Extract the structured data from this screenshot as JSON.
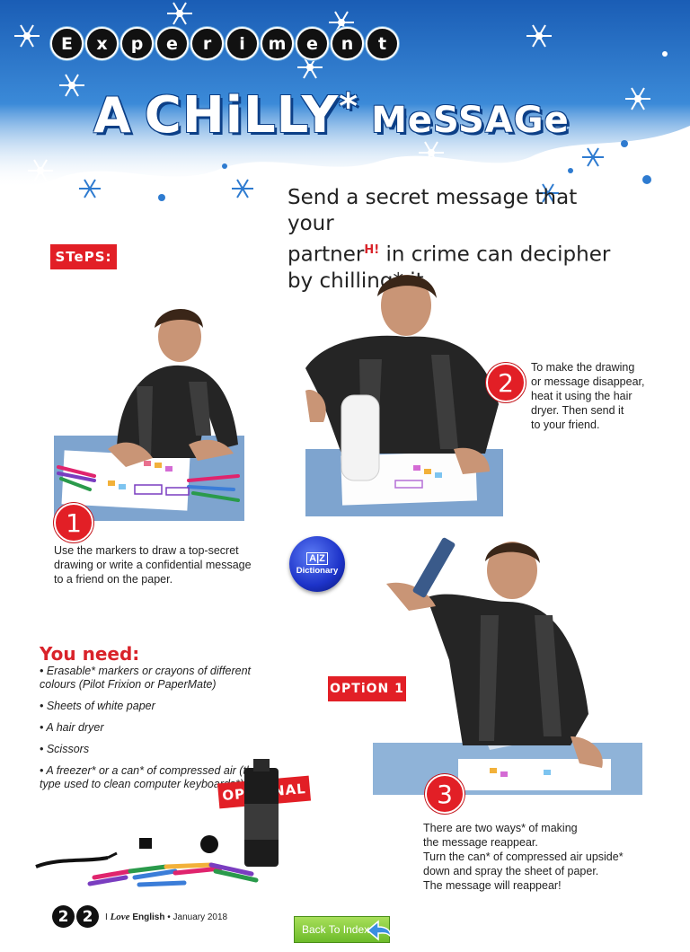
{
  "header": {
    "kicker_letters": [
      "E",
      "x",
      "p",
      "e",
      "r",
      "i",
      "m",
      "e",
      "n",
      "t"
    ],
    "title_a": "A",
    "title_b": "CHiLLY",
    "title_star": "*",
    "title_c": "MeSSAGe"
  },
  "intro": {
    "line1": "Send a secret message that your",
    "line2a": "partner",
    "line2_mark": "H!",
    "line2b": " in crime can decipher",
    "line3": "by chilling* it."
  },
  "steps_label": "STePS:",
  "steps": [
    {
      "number": "1",
      "text": "Use the markers to draw a top-secret drawing or write a confidential message to a friend on the paper."
    },
    {
      "number": "2",
      "text_lines": [
        "To make the drawing",
        "or message disappear,",
        "heat it using the hair",
        "dryer. Then send it",
        "to your friend."
      ]
    },
    {
      "number": "3",
      "text_lines": [
        "There are two ways* of making",
        "the message reappear.",
        "Turn the can* of compressed air upside*",
        "down and spray the sheet of paper.",
        "The message will reappear!"
      ]
    }
  ],
  "dictionary": {
    "az": "A|Z",
    "label": "Dictionary"
  },
  "option1_label": "OPTiON 1",
  "optional_label": "OPTiONAL",
  "you_need": {
    "title": "You need:",
    "items": [
      "• Erasable* markers or crayons of different colours (Pilot Frixion or PaperMate)",
      "• Sheets of white paper",
      "• A hair dryer",
      "• Scissors",
      "• A freezer* or a can* of compressed air (the type used to clean computer keyboards*)"
    ]
  },
  "footer": {
    "page_digits": [
      "2",
      "2"
    ],
    "magazine_prefix": "I ",
    "magazine_italic": "Love",
    "magazine_suffix": " English",
    "issue": " • January 2018",
    "back_button": "Back To Index"
  },
  "colors": {
    "accent_red": "#e21f26",
    "header_blue": "#1f64b8"
  }
}
